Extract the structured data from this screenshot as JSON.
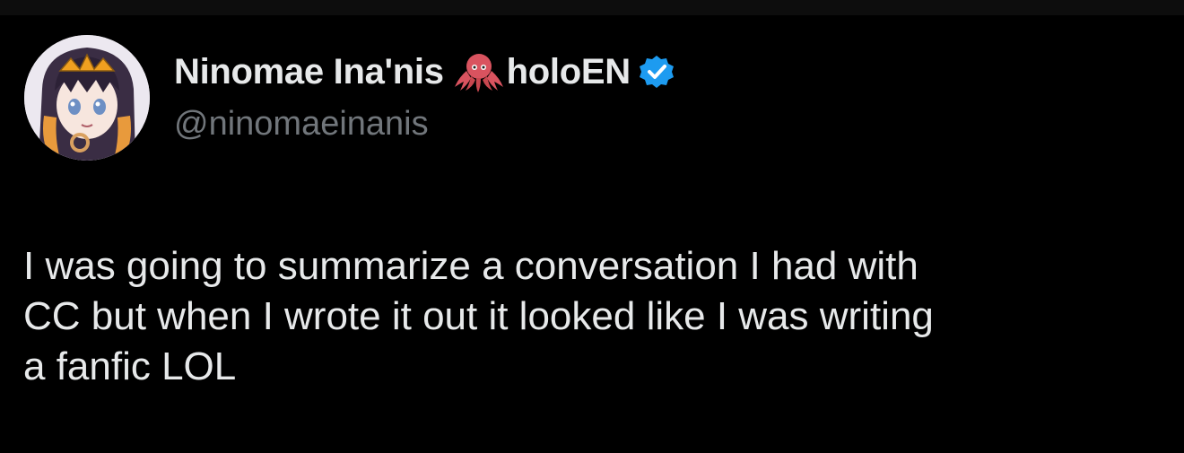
{
  "author": {
    "display_name": "Ninomae Ina'nis",
    "affiliation": "holoEN",
    "handle": "@ninomaeinanis",
    "name_emoji": "octopus-icon",
    "badge": "verified-badge-icon"
  },
  "tweet": {
    "lines": [
      "I was going to summarize a conversation I had with",
      "CC but when I wrote it out it looked like I was writing",
      "a fanfic LOL"
    ]
  },
  "colors": {
    "background": "#000000",
    "text_primary": "#e7e9ea",
    "text_secondary": "#71767b",
    "verified_blue": "#1d9bf0"
  }
}
